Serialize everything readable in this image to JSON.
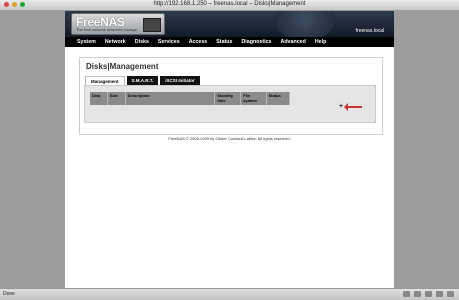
{
  "window": {
    "title": "http://192.168.1.250 – freenas.local – Disks|Management"
  },
  "banner": {
    "logo": "FreeNAS",
    "tagline": "The free network attached storage",
    "host": "freenas.local"
  },
  "nav": [
    "System",
    "Network",
    "Disks",
    "Services",
    "Access",
    "Status",
    "Diagnostics",
    "Advanced",
    "Help"
  ],
  "page": {
    "title": "Disks|Management"
  },
  "tabs": [
    "Management",
    "S.M.A.R.T.",
    "iSCSI Initiator"
  ],
  "table": {
    "headers": [
      "Disk",
      "Size",
      "Description",
      "Standby time",
      "File system",
      "Status"
    ]
  },
  "actions": {
    "add": "+"
  },
  "footer": {
    "text": "FreeNAS © 2005-2009 by Olivier Cochard-Labbé. All rights reserved."
  },
  "statusbar": {
    "text": "Done"
  }
}
